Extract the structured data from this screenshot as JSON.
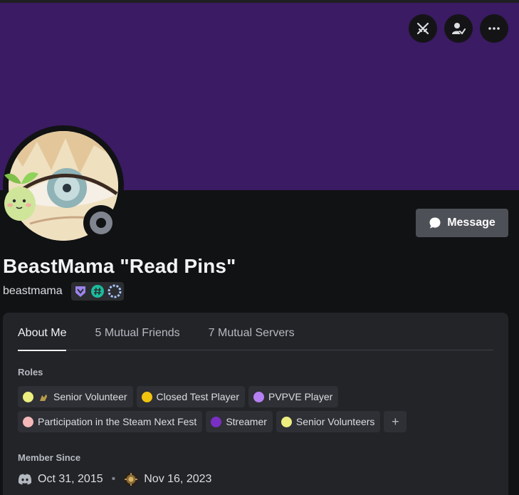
{
  "profile": {
    "display_name": "BeastMama \"Read Pins\"",
    "username": "beastmama",
    "banner_color": "#3b1b63",
    "status": "offline",
    "badges": [
      "hypesquad-icon",
      "hashtag-icon",
      "nitro-icon"
    ]
  },
  "actions": {
    "icons": [
      "swords-icon",
      "user-check-icon",
      "more-icon"
    ],
    "message_label": "Message"
  },
  "tabs": [
    {
      "label": "About Me",
      "active": true
    },
    {
      "label": "5 Mutual Friends",
      "active": false
    },
    {
      "label": "7 Mutual Servers",
      "active": false
    }
  ],
  "roles_section": {
    "title": "Roles",
    "roles": [
      {
        "label": "Senior Volunteer",
        "color": "#ecee80",
        "has_icon": true
      },
      {
        "label": "Closed Test Player",
        "color": "#f1c40f"
      },
      {
        "label": "PVPVE Player",
        "color": "#b580f2"
      },
      {
        "label": "Participation in the Steam Next Fest",
        "color": "#f4b8b8"
      },
      {
        "label": "Streamer",
        "color": "#7a2fc4"
      },
      {
        "label": "Senior Volunteers",
        "color": "#ecee80"
      }
    ],
    "add_label": "+"
  },
  "member_since": {
    "title": "Member Since",
    "discord_date": "Oct 31, 2015",
    "separator": "•",
    "server_date": "Nov 16, 2023"
  }
}
